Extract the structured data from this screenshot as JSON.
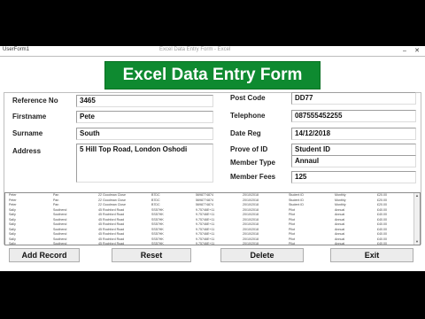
{
  "window": {
    "title": "UserForm1",
    "center_title": "Excel Data Entry Form - Excel"
  },
  "banner": {
    "title": "Excel Data Entry Form"
  },
  "form": {
    "left": [
      {
        "label": "Reference No",
        "value": "3465"
      },
      {
        "label": "Firstname",
        "value": "Pete"
      },
      {
        "label": "Surname",
        "value": "South"
      },
      {
        "label": "Address",
        "value": "5 Hill Top Road, London Oshodi"
      }
    ],
    "right": [
      {
        "label": "Post Code",
        "value": "DD77"
      },
      {
        "label": "Telephone",
        "value": "087555452255"
      },
      {
        "label": "Date Reg",
        "value": "14/12/2018"
      },
      {
        "label": "Prove of ID",
        "value": "Student ID"
      },
      {
        "label": "Member Type",
        "value": "Annaul"
      },
      {
        "label": "Member Fees",
        "value": "125"
      }
    ]
  },
  "records": [
    [
      "Peter",
      "Pan",
      "22 Goodman Close",
      "B7DC",
      "5698774874",
      "20/10/2018",
      "Student ID",
      "Monthly",
      "£20.00"
    ],
    [
      "Peter",
      "Pan",
      "22 Goodman Close",
      "B7DC",
      "5698774874",
      "20/10/2018",
      "Student ID",
      "Monthly",
      "£20.00"
    ],
    [
      "Peter",
      "Pan",
      "22 Goodman Close",
      "B7DC",
      "5698774874",
      "20/10/2018",
      "Student ID",
      "Monthly",
      "£20.00"
    ],
    [
      "Sally",
      "Southend",
      "45 Rochford Road",
      "SS57HK",
      "9.75746E+11",
      "20/10/2018",
      "Pilot",
      "Annual",
      "£40.00"
    ],
    [
      "Sally",
      "Southend",
      "45 Rochford Road",
      "SS57HK",
      "9.75746E+11",
      "20/10/2018",
      "Pilot",
      "Annual",
      "£40.00"
    ],
    [
      "Sally",
      "Southend",
      "45 Rochford Road",
      "SS57HK",
      "9.75746E+11",
      "20/10/2018",
      "Pilot",
      "Annual",
      "£40.00"
    ],
    [
      "Sally",
      "Southend",
      "45 Rochford Road",
      "SS57HK",
      "9.75746E+11",
      "20/10/2018",
      "Pilot",
      "Annual",
      "£40.00"
    ],
    [
      "Sally",
      "Southend",
      "45 Rochford Road",
      "SS57HK",
      "9.75746E+11",
      "20/10/2018",
      "Pilot",
      "Annual",
      "£40.00"
    ],
    [
      "Sally",
      "Southend",
      "45 Rochford Road",
      "SS57HK",
      "9.75746E+11",
      "20/10/2018",
      "Pilot",
      "Annual",
      "£40.00"
    ],
    [
      "Sally",
      "Southend",
      "45 Rochford Road",
      "SS57HK",
      "9.75746E+11",
      "20/10/2018",
      "Pilot",
      "Annual",
      "£40.00"
    ],
    [
      "Sally",
      "Southend",
      "45 Rochford Road",
      "SS57HK",
      "9.75746E+11",
      "20/10/2018",
      "Pilot",
      "Annual",
      "£40.00"
    ]
  ],
  "buttons": {
    "add": "Add Record",
    "reset": "Reset",
    "delete": "Delete",
    "exit": "Exit"
  },
  "icons": {
    "close": "close-icon",
    "minimize": "minimize-icon",
    "scroll_up": "scroll-up-icon",
    "scroll_down": "scroll-down-icon"
  },
  "colors": {
    "banner": "#0e8a30",
    "banner_text": "#ffffff"
  }
}
